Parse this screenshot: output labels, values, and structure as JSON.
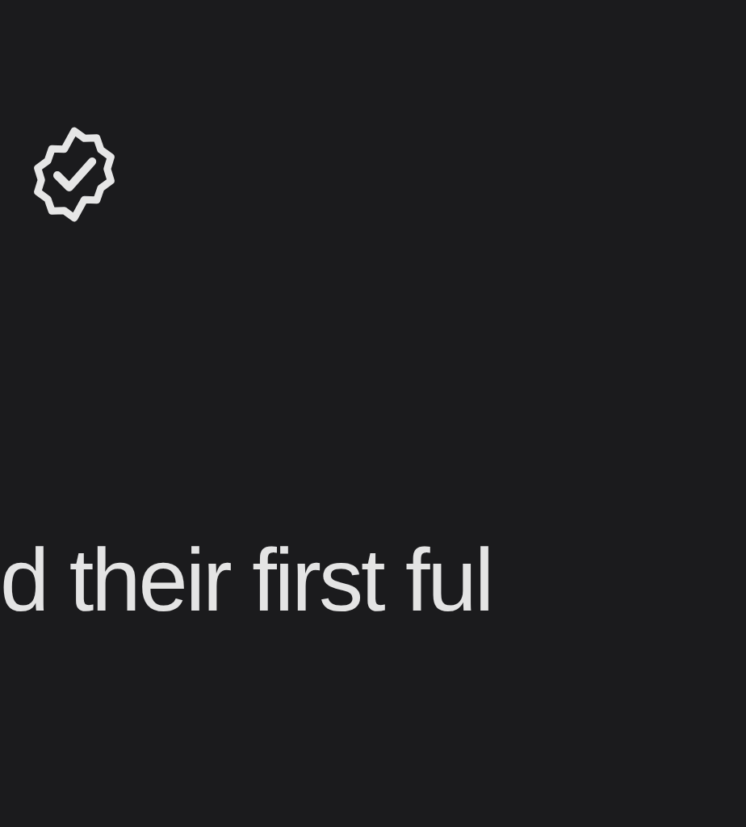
{
  "verified_badge": {
    "kind": "badge-check"
  },
  "text": "d their first ful"
}
